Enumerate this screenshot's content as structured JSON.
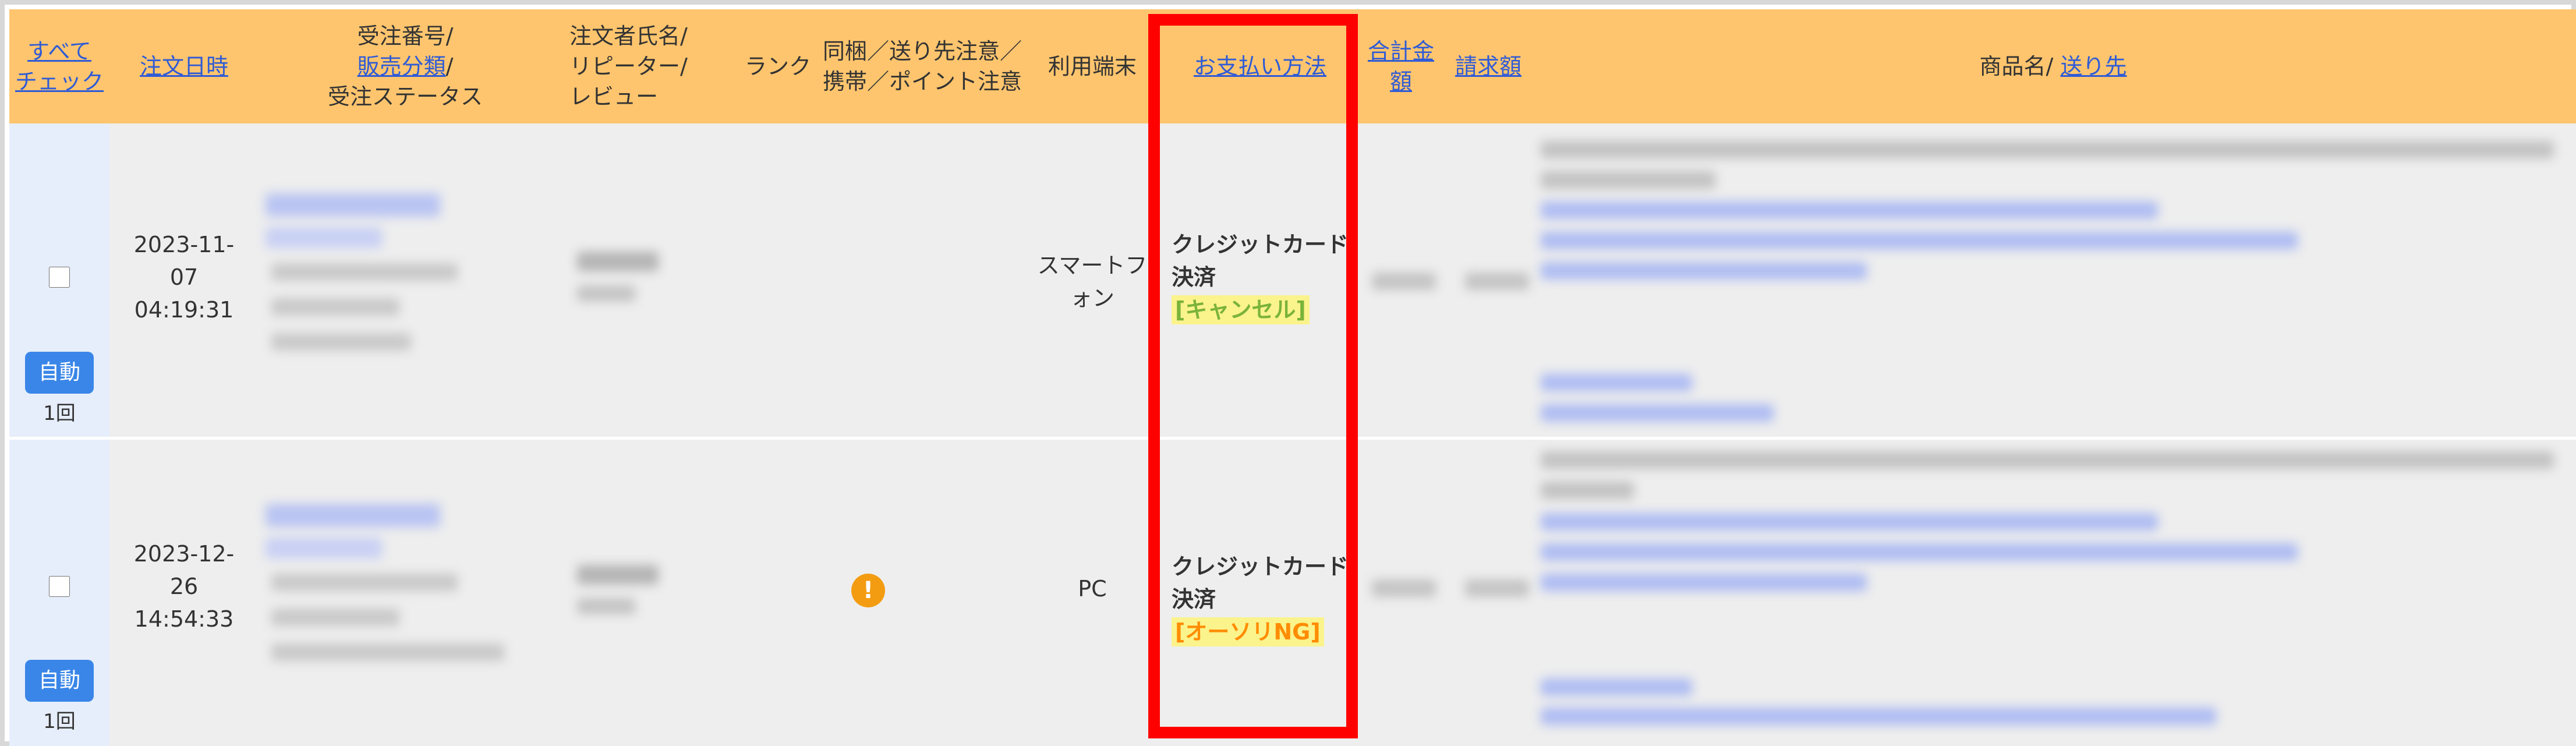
{
  "header": {
    "check_all_line1": "すべて",
    "check_all_line2": "チェック",
    "order_datetime": "注文日時",
    "order_number": "受注番号/",
    "sales_category": "販売分類",
    "sales_category_slash": "/",
    "order_status": "受注ステータス",
    "customer_line1": "注文者氏名/",
    "customer_line2": "リピーター/",
    "customer_line3": "レビュー",
    "rank": "ランク",
    "notice_line1": "同梱／送り先注意／",
    "notice_line2": "携帯／ポイント注意",
    "device": "利用端末",
    "payment_method": "お支払い方法",
    "total_line1": "合計金",
    "total_line2": "額",
    "billing": "請求額",
    "product_name": "商品名/ ",
    "ship_to": "送り先"
  },
  "rows": [
    {
      "date": "2023-11-",
      "date2": "07",
      "time": "04:19:31",
      "device_line1": "スマートフ",
      "device_line2": "ォン",
      "payment_line1": "クレジットカード",
      "payment_line2": "決済",
      "payment_status": "[キャンセル]",
      "auto_button": "自動",
      "auto_count": "1回",
      "has_warning": false
    },
    {
      "date": "2023-12-",
      "date2": "26",
      "time": "14:54:33",
      "device_line1": "PC",
      "device_line2": "",
      "payment_line1": "クレジットカード",
      "payment_line2": "決済",
      "payment_status": "[オーソリNG]",
      "auto_button": "自動",
      "auto_count": "1回",
      "has_warning": true,
      "warning_glyph": "!"
    }
  ],
  "colors": {
    "header_bg": "#fec56e",
    "link": "#2f5bd6",
    "highlight_border": "#ff0000",
    "auto_button": "#3a86e8",
    "cancel_tag_text": "#7ab33a",
    "ng_tag_text": "#ff8c00",
    "tag_bg": "#fbf38c"
  }
}
